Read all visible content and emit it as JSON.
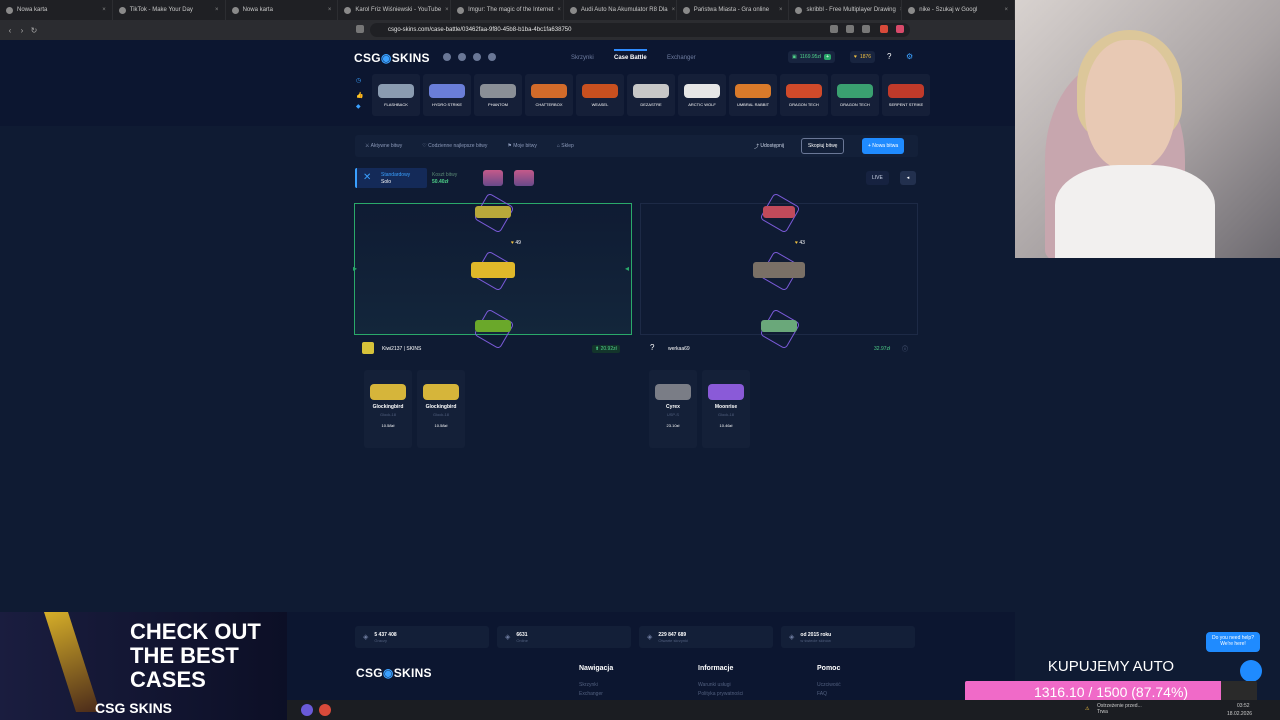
{
  "browser": {
    "tabs": [
      "Nowa karta",
      "TikTok - Make Your Day",
      "Nowa karta",
      "Karol Friz Wiśniewski - YouTube",
      "Imgur: The magic of the Internet",
      "Audi Auto Na Akumulator R8 Dla",
      "Państwa Miasta - Gra online",
      "skribbl - Free Multiplayer Drawing",
      "nike - Szukaj w Googl"
    ],
    "url": "csgo-skins.com/case-battle/03462faa-9f80-45b8-b1ba-4bc1fa638750"
  },
  "site": {
    "logo_left": "CSG",
    "logo_right": "SKINS",
    "nav": [
      "Skrzynki",
      "Case Battle",
      "Exchanger"
    ],
    "balance": "1169.95zł",
    "coins": "1876",
    "help": "?",
    "strip": [
      {
        "name": "FLASHBACK",
        "color": "#8a9bb0"
      },
      {
        "name": "HYDRO STRIKE",
        "color": "#6a7ed8"
      },
      {
        "name": "PHANTOM",
        "color": "#8a8f96"
      },
      {
        "name": "CHATTERBOX",
        "color": "#d26b2a"
      },
      {
        "name": "WEASEL",
        "color": "#c8501f"
      },
      {
        "name": "DEZASTRE",
        "color": "#c7c7c7"
      },
      {
        "name": "ARCTIC WOLF",
        "color": "#e6e6e6"
      },
      {
        "name": "UMBRAL RABBIT",
        "color": "#d97a2a"
      },
      {
        "name": "DRAGON TECH",
        "color": "#d04a2a"
      },
      {
        "name": "DRAGON TECH",
        "color": "#3aa070"
      },
      {
        "name": "SERPENT STRIKE",
        "color": "#c03a2a"
      }
    ]
  },
  "battle": {
    "nav": [
      "Aktywne bitwy",
      "Codzienne najlepsze bitwy",
      "Moje bitwy",
      "Sklep"
    ],
    "share": "Udostępnij",
    "copy": "Skopiuj bitwę",
    "new": "+ Nowa bitwa",
    "mode_title": "Standardowy",
    "mode_sub": "Solo",
    "cost_label": "Koszt bitwy",
    "cost_value": "50.40zł",
    "live": "LIVE",
    "reel_left_badge": "49",
    "reel_right_badge": "43",
    "players": [
      {
        "name": "Kiwi2137 | SKINS",
        "total": "20.92zł",
        "items": [
          {
            "name": "Glockingbird",
            "sub": "Glock-18",
            "price": "10.58zł",
            "color": "#d6b53a"
          },
          {
            "name": "Glockingbird",
            "sub": "Glock-18",
            "price": "10.58zł",
            "color": "#d6b53a"
          }
        ]
      },
      {
        "name": "werkaa69",
        "total": "32.97zł",
        "items": [
          {
            "name": "Cyrex",
            "sub": "USP-S",
            "price": "23.10zł",
            "color": "#7a7d86"
          },
          {
            "name": "Moonrise",
            "sub": "Glock-18",
            "price": "10.46zł",
            "color": "#8a5ad8"
          }
        ]
      }
    ]
  },
  "footer": {
    "stats": [
      {
        "value": "5 437 408",
        "label": "Graczy"
      },
      {
        "value": "6631",
        "label": "Online"
      },
      {
        "value": "229 847 689",
        "label": "Otwarte skrzynki"
      },
      {
        "value": "od 2015 roku",
        "label": "w świecie skinów"
      }
    ],
    "cols": [
      {
        "title": "Nawigacja",
        "items": [
          "Skrzynki",
          "Exchanger"
        ]
      },
      {
        "title": "Informacje",
        "items": [
          "Warunki usługi",
          "Polityka prywatności"
        ]
      },
      {
        "title": "Pomoc",
        "items": [
          "Uczciwość",
          "FAQ"
        ]
      }
    ],
    "help_bubble": "Do you need help? We're here!"
  },
  "overlay": {
    "ad_text": "CHECK OUT THE BEST CASES",
    "ad_brand": "CSG SKINS",
    "goal_title": "KUPUJEMY AUTO",
    "goal_text": "1316.10 / 1500 (87.74%)",
    "goal_fraction": 0.8774
  },
  "taskbar": {
    "time": "03:52",
    "date": "18.02.2026",
    "weather": "Ostrzeżenie przed... Trwa"
  }
}
